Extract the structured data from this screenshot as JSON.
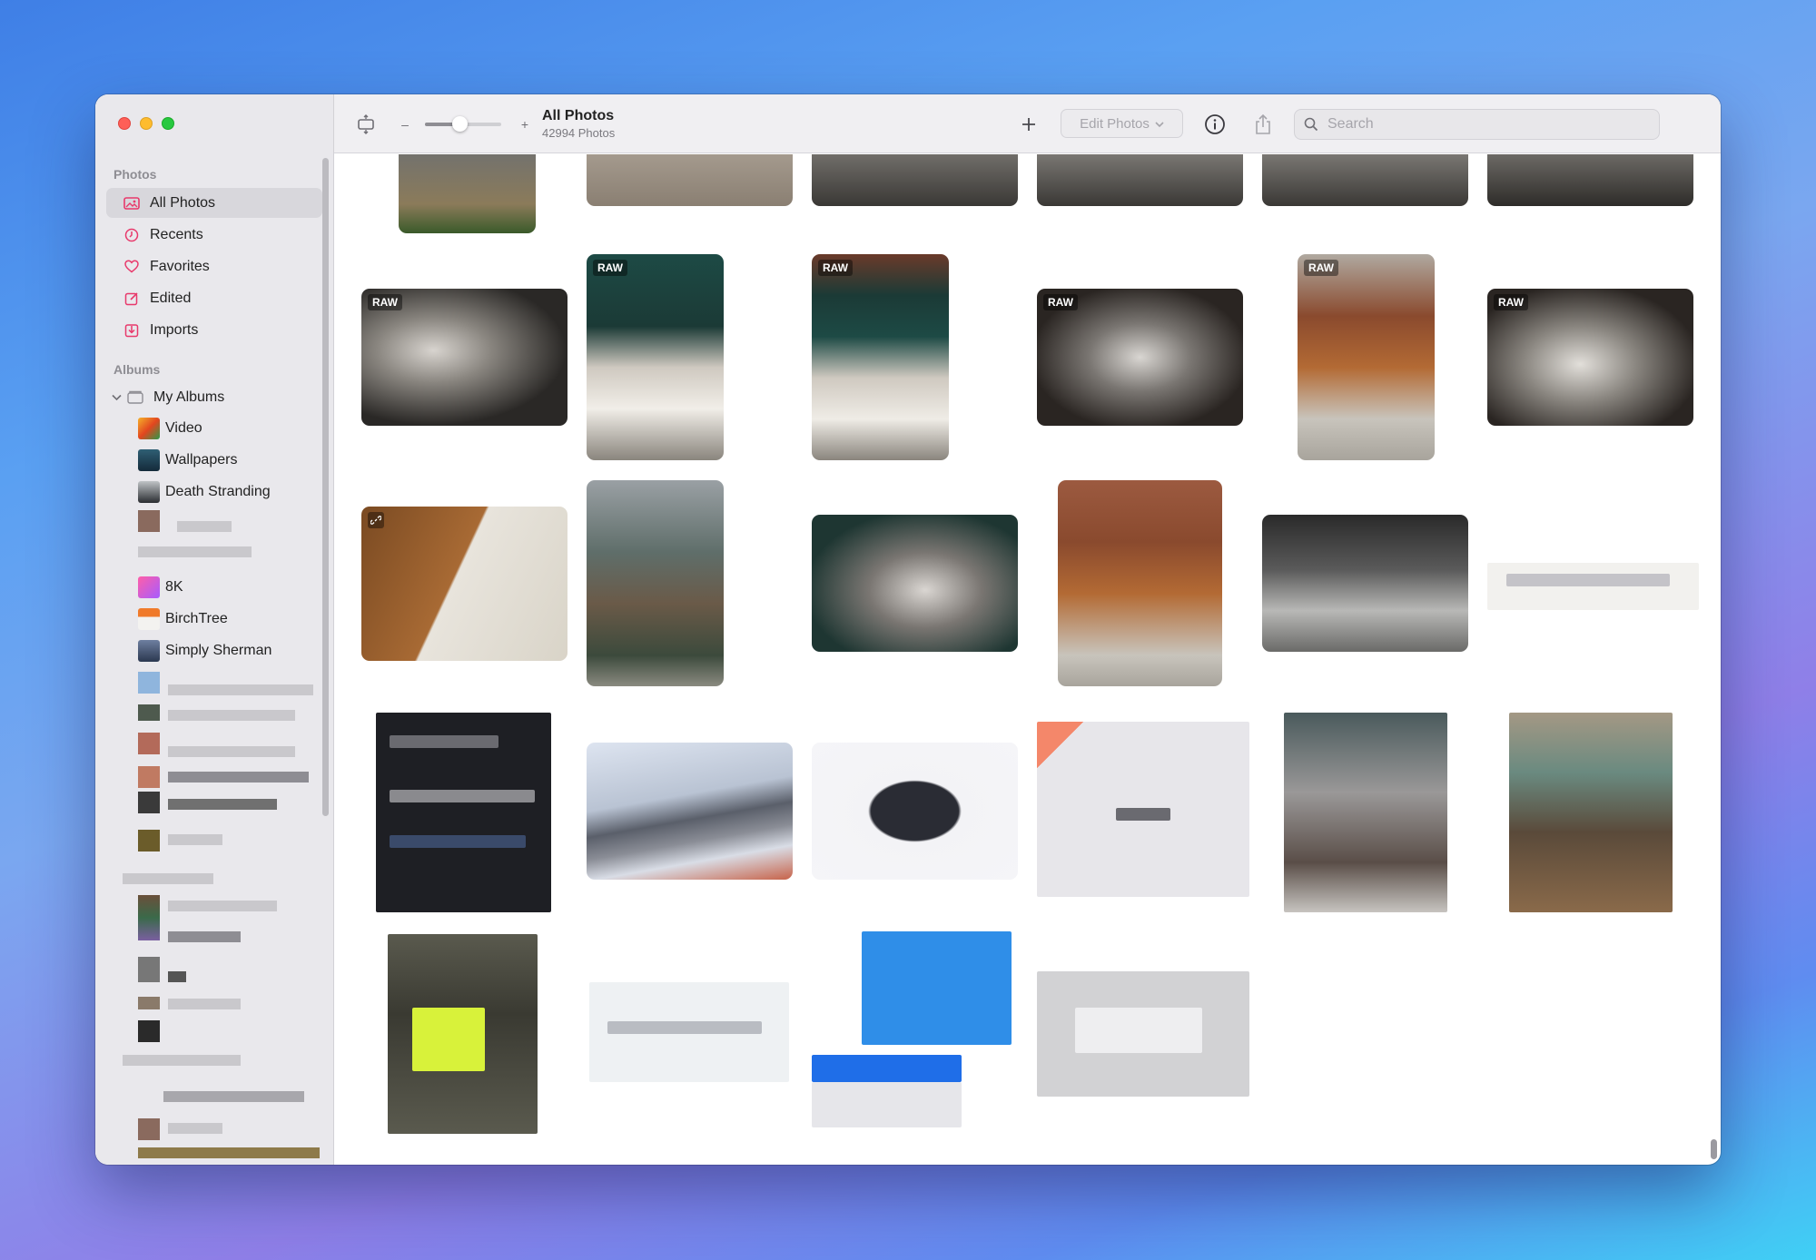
{
  "window": {
    "title": "All Photos"
  },
  "sidebar": {
    "sections": {
      "photos": "Photos",
      "albums": "Albums"
    },
    "library_items": [
      {
        "label": "All Photos",
        "icon": "photos-library-icon",
        "active": true
      },
      {
        "label": "Recents",
        "icon": "clock-icon"
      },
      {
        "label": "Favorites",
        "icon": "heart-icon"
      },
      {
        "label": "Edited",
        "icon": "edit-icon"
      },
      {
        "label": "Imports",
        "icon": "import-tray-icon"
      }
    ],
    "my_albums": {
      "label": "My Albums",
      "icon": "folder-icon"
    },
    "albums": [
      {
        "label": "Video"
      },
      {
        "label": "Wallpapers"
      },
      {
        "label": "Death Stranding"
      },
      {
        "label": "8K"
      },
      {
        "label": "BirchTree"
      },
      {
        "label": "Simply Sherman"
      }
    ]
  },
  "toolbar": {
    "title": "All Photos",
    "count": "42994 Photos",
    "edit_label": "Edit Photos",
    "search_placeholder": "Search",
    "zoom_level": 0.45
  },
  "grid": {
    "badge": "RAW"
  },
  "colors": {
    "accent": "#e8396b",
    "sidebar_bg": "#e9e8ec",
    "toolbar_bg": "#f0eff2"
  }
}
